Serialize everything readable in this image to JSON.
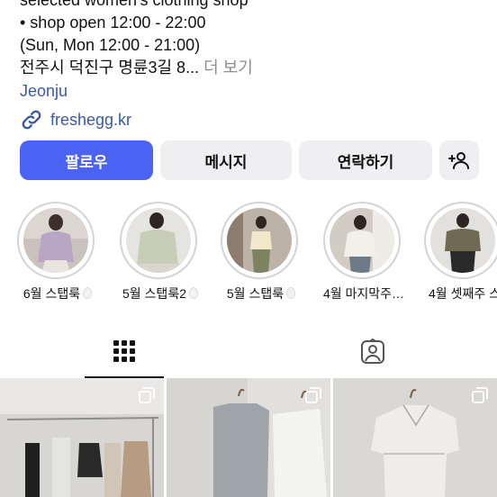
{
  "profile": {
    "bio_lines": [
      "selected women's clothing shop",
      "• shop open 12:00 - 22:00",
      "(Sun, Mon 12:00 - 21:00)"
    ],
    "address": "전주시 덕진구 명륜3길 8...",
    "more": "더 보기",
    "city": "Jeonju",
    "link": "freshegg.kr",
    "icons": {
      "link": "link-icon"
    }
  },
  "actions": {
    "follow": "팔로우",
    "message": "메시지",
    "contact": "연락하기",
    "add_user_icon": "add-person-icon",
    "colors": {
      "follow_bg": "#4a63f5",
      "button_bg": "#efeff1"
    }
  },
  "highlights": [
    {
      "label": "6월 스탭룩"
    },
    {
      "label": "5월 스탭룩2"
    },
    {
      "label": "5월 스탭룩"
    },
    {
      "label": "4월 마지막주…"
    },
    {
      "label": "4월 셋째주 스"
    }
  ],
  "tabs": [
    {
      "name": "posts-grid",
      "icon": "grid-icon",
      "active": true
    },
    {
      "name": "tagged",
      "icon": "tagged-person-icon",
      "active": false
    }
  ],
  "posts": [
    {
      "icon": "multiple-photos-icon"
    },
    {
      "icon": "multiple-photos-icon"
    },
    {
      "icon": "multiple-photos-icon"
    }
  ]
}
